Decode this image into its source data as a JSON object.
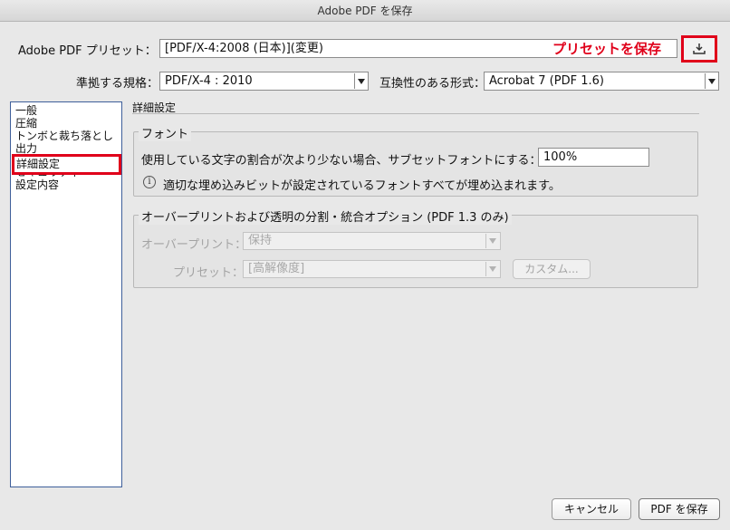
{
  "window": {
    "title": "Adobe PDF を保存"
  },
  "preset": {
    "label": "Adobe PDF プリセット：",
    "value": "[PDF/X-4:2008 (日本)](変更)",
    "save_annotation": "プリセットを保存",
    "save_icon": "save-preset-icon"
  },
  "standard": {
    "label": "準拠する規格：",
    "value": "PDF/X-4 : 2010"
  },
  "compatibility": {
    "label": "互換性のある形式：",
    "value": "Acrobat 7 (PDF 1.6)"
  },
  "sidebar": {
    "items": [
      {
        "label": "一般"
      },
      {
        "label": "圧縮"
      },
      {
        "label": "トンボと裁ち落とし"
      },
      {
        "label": "出力"
      },
      {
        "label": "詳細設定"
      },
      {
        "label": "セキュリティ"
      },
      {
        "label": "設定内容"
      }
    ]
  },
  "main": {
    "section_title": "詳細設定",
    "font_group": {
      "title": "フォント",
      "subset_label": "使用している文字の割合が次より少ない場合、サブセットフォントにする：",
      "subset_value": "100%",
      "info_text": "適切な埋め込みビットが設定されているフォントすべてが埋め込まれます。",
      "info_icon": "info-icon"
    },
    "overprint_group": {
      "title": "オーバープリントおよび透明の分割・統合オプション (PDF 1.3 のみ)",
      "overprint_label": "オーバープリント：",
      "overprint_value": "保持",
      "preset_label": "プリセット：",
      "preset_value": "[高解像度]",
      "custom_button": "カスタム..."
    }
  },
  "footer": {
    "cancel": "キャンセル",
    "save": "PDF を保存"
  },
  "colors": {
    "annotation": "#e0001a",
    "sidebar_border": "#3e5f9a"
  }
}
